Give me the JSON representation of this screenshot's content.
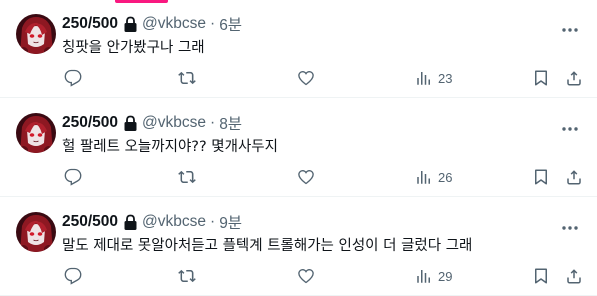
{
  "tweets": [
    {
      "name": "250/500",
      "handle": "@vkbcse",
      "separator": "·",
      "time": "6분",
      "text": "칭팟을 안가봤구나 그래",
      "views": "23"
    },
    {
      "name": "250/500",
      "handle": "@vkbcse",
      "separator": "·",
      "time": "8분",
      "text": "헐 팔레트 오늘까지야?? 몇개사두지",
      "views": "26"
    },
    {
      "name": "250/500",
      "handle": "@vkbcse",
      "separator": "·",
      "time": "9분",
      "text": "말도 제대로 못알아처듣고 플텍계 트롤해가는 인성이 더 글렀다 그래",
      "views": "29"
    }
  ],
  "icons": {
    "lock": "lock-icon",
    "more": "more-icon",
    "reply": "reply-icon",
    "retweet": "retweet-icon",
    "like": "like-icon",
    "views": "views-icon",
    "bookmark": "bookmark-icon",
    "share": "share-icon"
  },
  "colors": {
    "text": "#0f1419",
    "secondary": "#536471",
    "divider": "#eff3f4",
    "accent": "#f91880"
  }
}
